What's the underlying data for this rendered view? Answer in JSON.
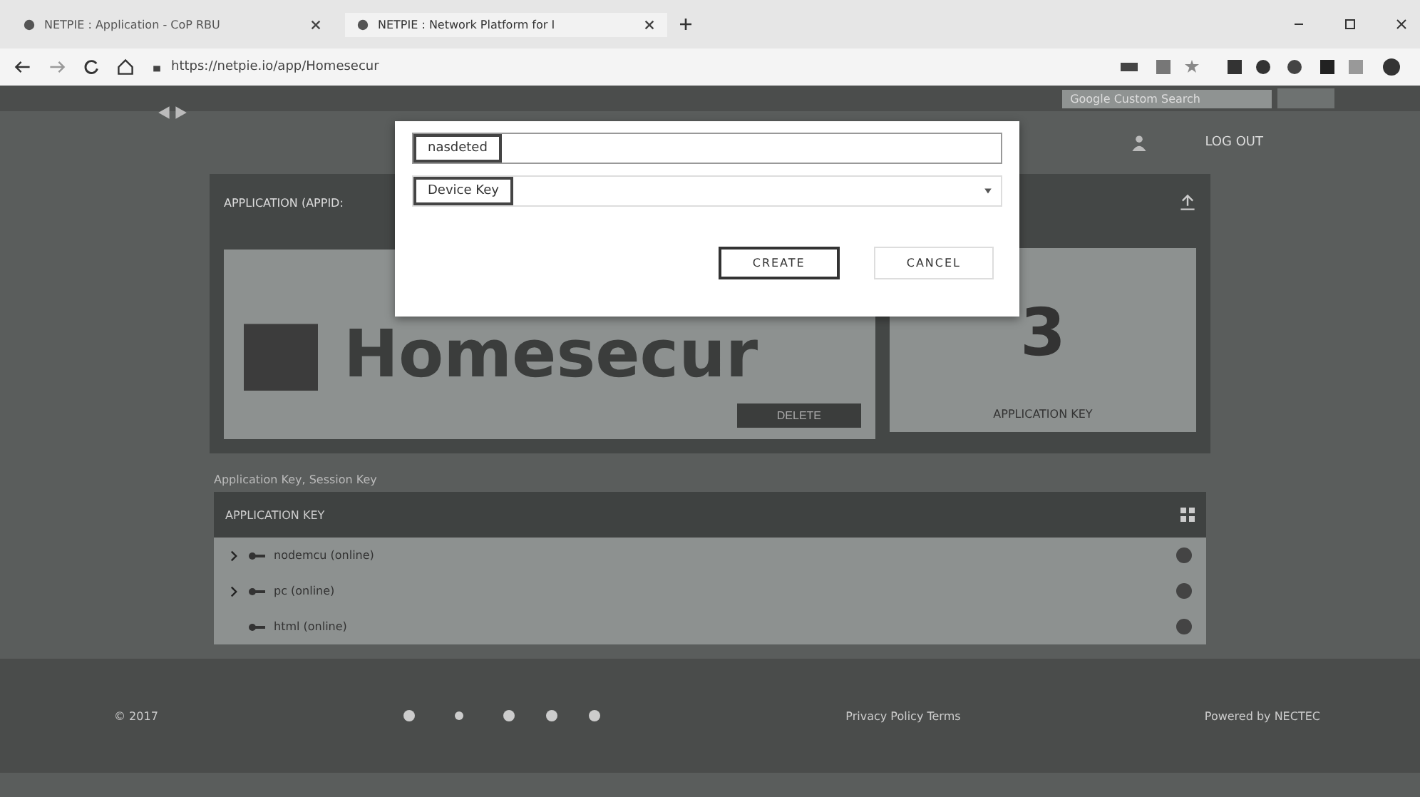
{
  "browser": {
    "tabs": [
      {
        "title": "NETPIE : Application - CoP RBU",
        "selected": false
      },
      {
        "title": "NETPIE : Network Platform for I",
        "selected": true
      }
    ],
    "url": "https://netpie.io/app/Homesecur"
  },
  "header": {
    "search": {
      "placeholder": "Google Custom Search"
    },
    "logout": "LOG OUT"
  },
  "app_card": {
    "title": "APPLICATION (APPID:",
    "name": "Homesecur",
    "delete": "DELETE"
  },
  "count_card": {
    "count": "3",
    "label": "APPLICATION KEY"
  },
  "note": "Application Key, Session Key",
  "keys": {
    "title": "APPLICATION KEY",
    "rows": [
      {
        "kind": "group",
        "label": "nodemcu (online)"
      },
      {
        "kind": "group",
        "label": "pc (online)"
      },
      {
        "kind": "leaf",
        "label": "html (online)"
      }
    ]
  },
  "footer": {
    "left": "© 2017",
    "middle": "Privacy Policy Terms",
    "right": "Powered by NECTEC"
  },
  "dialog": {
    "name_value": "nasdeted",
    "type": "Device Key",
    "buttons": [
      "CREATE",
      "CANCEL"
    ]
  }
}
